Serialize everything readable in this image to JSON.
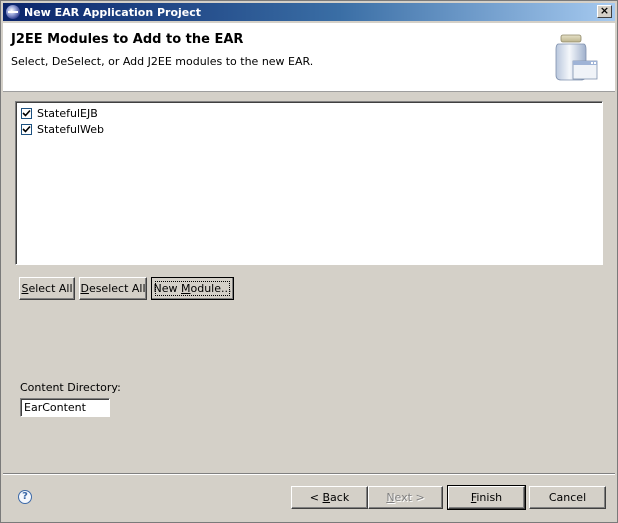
{
  "window": {
    "title": "New EAR Application Project",
    "close_glyph": "×"
  },
  "banner": {
    "title": "J2EE Modules to Add to the EAR",
    "description": "Select, DeSelect, or Add J2EE modules to the new EAR."
  },
  "modules": {
    "items": [
      {
        "label": "StatefulEJB",
        "checked": true
      },
      {
        "label": "StatefulWeb",
        "checked": true
      }
    ]
  },
  "module_buttons": {
    "select_all_pre": "",
    "select_all_u": "S",
    "select_all_post": "elect All",
    "deselect_all_pre": "",
    "deselect_all_u": "D",
    "deselect_all_post": "eselect All",
    "new_module_pre": "New ",
    "new_module_u": "M",
    "new_module_post": "odule..."
  },
  "content_directory": {
    "label": "Content Directory:",
    "value": "EarContent"
  },
  "footer": {
    "help_glyph": "?",
    "back_pre": "< ",
    "back_u": "B",
    "back_post": "ack",
    "next_pre": "",
    "next_u": "N",
    "next_post": "ext >",
    "finish_pre": "",
    "finish_u": "F",
    "finish_post": "inish",
    "cancel_label": "Cancel"
  },
  "colors": {
    "dialog_bg": "#d4d0c8",
    "title_bar_start": "#0a246a",
    "title_bar_end": "#a6caf0"
  }
}
